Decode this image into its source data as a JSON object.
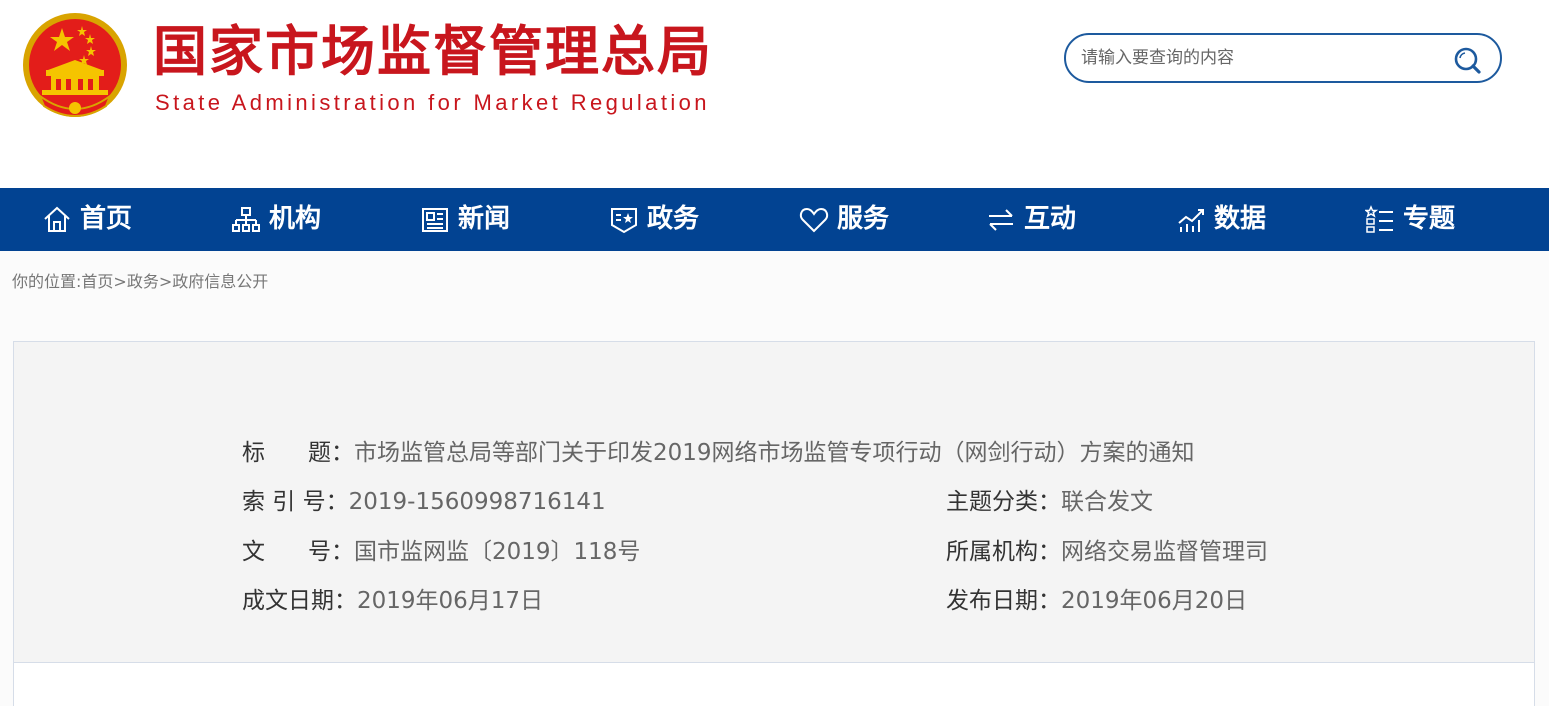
{
  "header": {
    "site_title": "国家市场监督管理总局",
    "site_subtitle": "State Administration for Market Regulation",
    "search": {
      "placeholder": "请输入要查询的内容"
    }
  },
  "nav": {
    "items": [
      {
        "label": "首页",
        "icon": "home-icon"
      },
      {
        "label": "机构",
        "icon": "org-icon"
      },
      {
        "label": "新闻",
        "icon": "news-icon"
      },
      {
        "label": "政务",
        "icon": "government-icon"
      },
      {
        "label": "服务",
        "icon": "heart-icon"
      },
      {
        "label": "互动",
        "icon": "exchange-icon"
      },
      {
        "label": "数据",
        "icon": "chart-icon"
      },
      {
        "label": "专题",
        "icon": "topic-list-icon"
      }
    ]
  },
  "breadcrumb": {
    "prefix": "你的位置:",
    "items": [
      "首页",
      "政务",
      "政府信息公开"
    ],
    "separator": ">"
  },
  "info": {
    "title_label_a": "标",
    "title_label_b": "题：",
    "title_value": "市场监管总局等部门关于印发2019网络市场监管专项行动（网剑行动）方案的通知",
    "index_label": "索 引 号：",
    "index_value": "2019-1560998716141",
    "topic_label": "主题分类：",
    "topic_value": "联合发文",
    "docno_label_a": "文",
    "docno_label_b": "号：",
    "docno_value": "国市监网监〔2019〕118号",
    "org_label": "所属机构：",
    "org_value": "网络交易监督管理司",
    "created_label": "成文日期：",
    "created_value": "2019年06月17日",
    "published_label": "发布日期：",
    "published_value": "2019年06月20日"
  },
  "colors": {
    "brand_red": "#c8161d",
    "nav_blue": "#024392",
    "search_border": "#1d5a9e",
    "emblem_gold": "#f5c400"
  }
}
